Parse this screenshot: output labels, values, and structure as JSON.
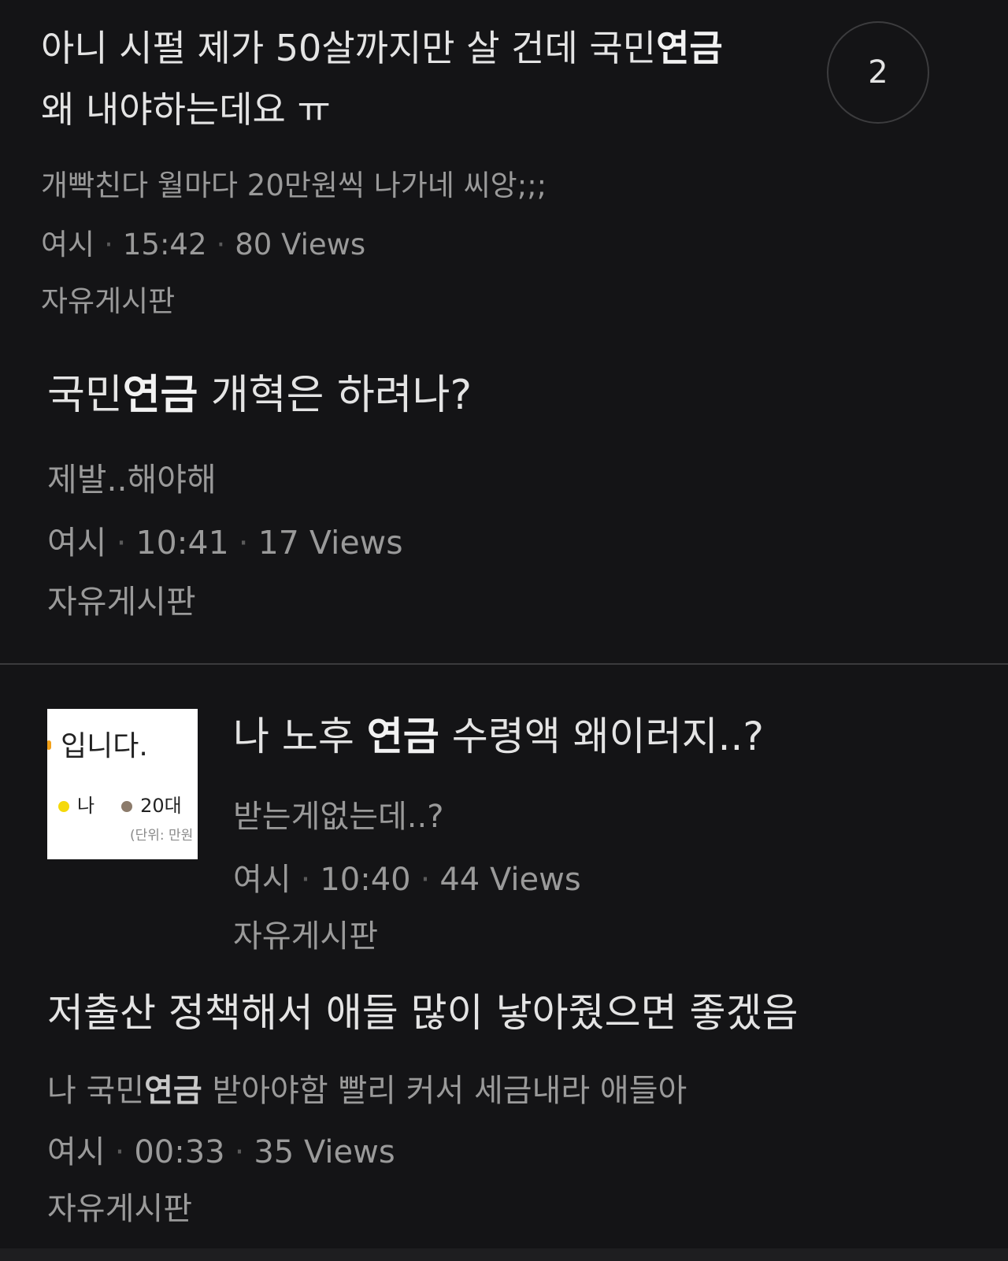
{
  "posts": [
    {
      "title_line1_pre": "아니 시펄 제가 50살까지만 살 건데 국민",
      "title_line1_hl": "연금",
      "title_line2": "왜 내야하는데요 ㅠ",
      "excerpt": "개빡친다 월마다 20만원씩 나가네 씨앙;;;",
      "author": "여시",
      "time": "15:42",
      "views": "80 Views",
      "board": "자유게시판",
      "comment_count": "2"
    },
    {
      "title_pre": "국민",
      "title_hl": "연금",
      "title_post": " 개혁은 하려나?",
      "excerpt": "제발..해야해",
      "author": "여시",
      "time": "10:41",
      "views": "17 Views",
      "board": "자유게시판"
    },
    {
      "title_pre": "나 노후 ",
      "title_hl": "연금",
      "title_post": " 수령액 왜이러지..?",
      "excerpt": "받는게없는데..?",
      "author": "여시",
      "time": "10:40",
      "views": "44 Views",
      "board": "자유게시판",
      "thumbnail": {
        "heading": "입니다.",
        "legend_me": "나",
        "legend_20s": "20대",
        "unit": "(단위: 만원",
        "color_me": "#f5d90a",
        "color_20s": "#8c7b6b"
      }
    },
    {
      "title": "저출산 정책해서 애들 많이 낳아줬으면 좋겠음",
      "excerpt_pre": "나 국민",
      "excerpt_hl": "연금",
      "excerpt_post": " 받아야함 빨리 커서 세금내라 애들아",
      "author": "여시",
      "time": "00:33",
      "views": "35 Views",
      "board": "자유게시판"
    }
  ],
  "separator": "·"
}
